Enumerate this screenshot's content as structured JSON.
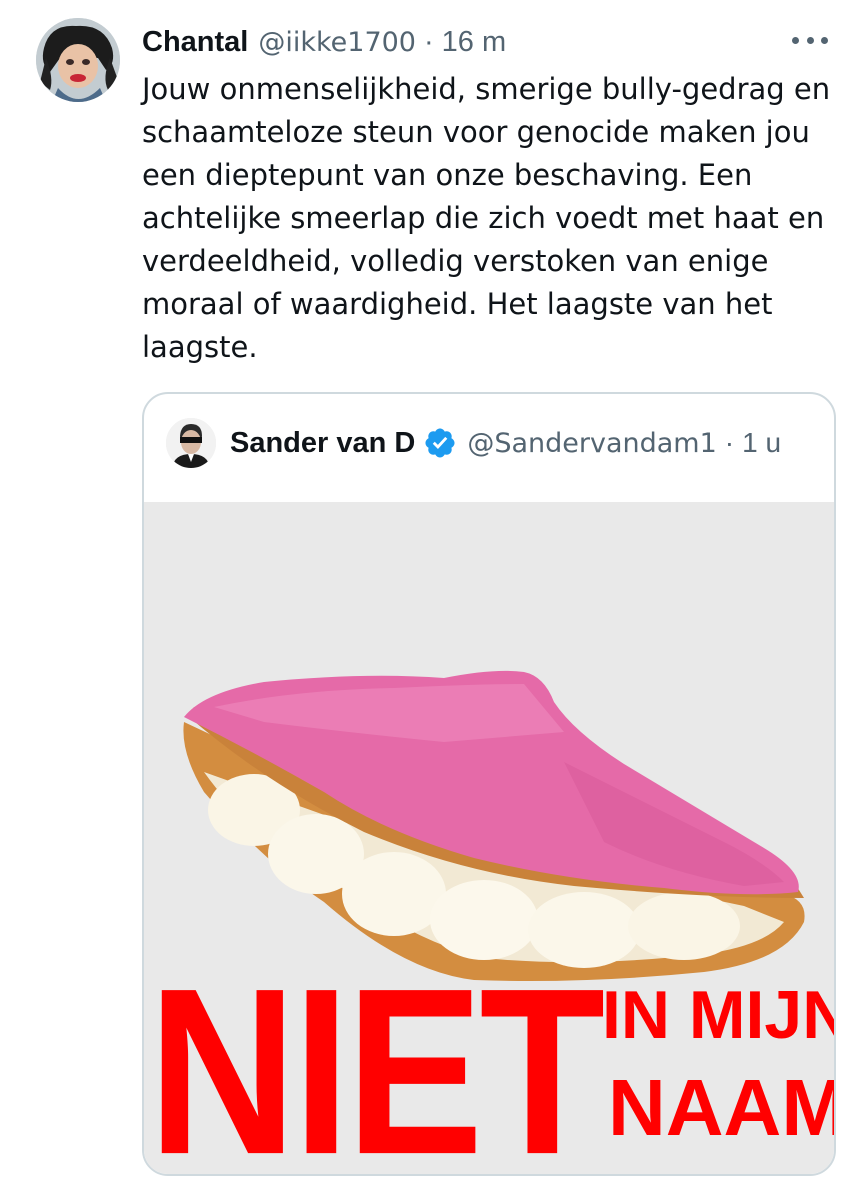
{
  "tweet": {
    "display_name": "Chantal",
    "handle": "@iikke1700",
    "separator": "·",
    "time": "16 m",
    "text": "Jouw onmenselijkheid, smerige bully-gedrag en\nschaamteloze steun voor genocide maken jou\neen dieptepunt van onze beschaving. Een\nachtelijke smeerlap die zich voedt met haat en\nverdeeldheid, volledig verstoken van enige\nmoraal of waardigheid. Het laagste van het\nlaagste."
  },
  "quoted": {
    "display_name": "Sander van D",
    "handle": "@Sandervandam1",
    "separator": "·",
    "time": "1 u",
    "verified": true,
    "image": {
      "text_large": "NIET",
      "text_top": "IN MIJN",
      "text_bottom": "NAAM",
      "text_color": "#ff0000",
      "icing_color": "#e56aa8"
    }
  },
  "colors": {
    "text": "#0f1419",
    "secondary": "#536471",
    "border": "#cfd9de",
    "verified": "#1d9bf0"
  },
  "icons": [
    "more-icon",
    "verified-badge-icon"
  ]
}
